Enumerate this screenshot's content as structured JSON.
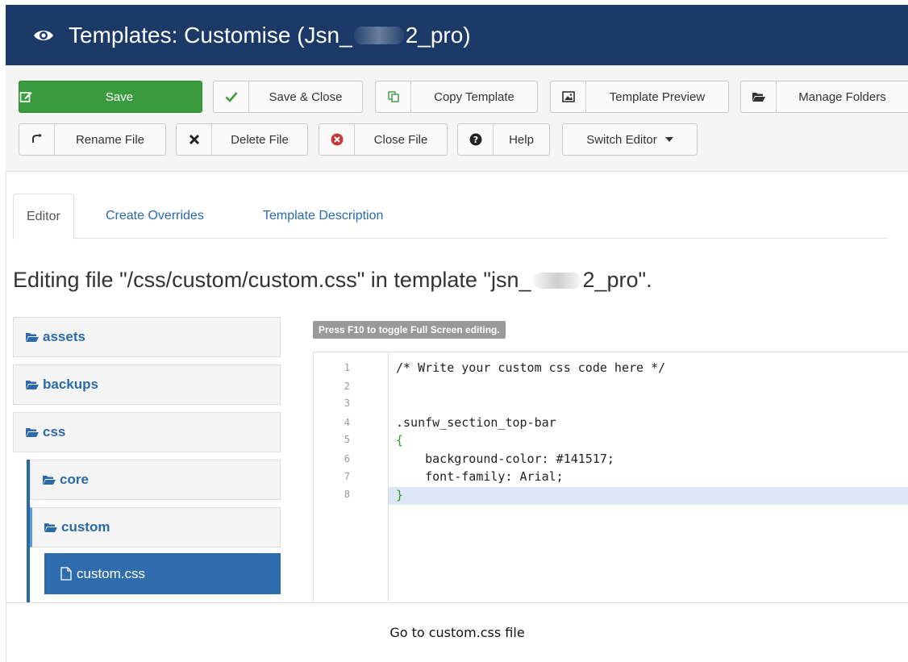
{
  "header": {
    "title_prefix": "Templates: Customise (Jsn_",
    "title_suffix": "2_pro)",
    "icon": "eye-icon",
    "bg_color": "#1b3a67"
  },
  "toolbar": {
    "save": "Save",
    "save_close": "Save & Close",
    "copy_template": "Copy Template",
    "template_preview": "Template Preview",
    "manage_folders": "Manage Folders",
    "rename_file": "Rename File",
    "delete_file": "Delete File",
    "close_file": "Close File",
    "help": "Help",
    "switch_editor": "Switch Editor",
    "save_color": "#3b9c3f"
  },
  "tabs": [
    {
      "label": "Editor",
      "active": true
    },
    {
      "label": "Create Overrides",
      "active": false
    },
    {
      "label": "Template Description",
      "active": false
    }
  ],
  "editing": {
    "prefix": "Editing file \"/css/custom/custom.css\" in template \"jsn_",
    "suffix": "2_pro\"."
  },
  "tree": {
    "items": [
      "assets",
      "backups",
      "css",
      "core",
      "custom"
    ],
    "active_file": "custom.css",
    "active_color": "#2f6cae"
  },
  "editor": {
    "f10_hint": "Press F10 to toggle Full Screen editing.",
    "line_numbers": [
      "1",
      "2",
      "3",
      "4",
      "5",
      "6",
      "7",
      "8"
    ],
    "lines": [
      "/* Write your custom css code here */",
      "",
      "",
      ".sunfw_section_top-bar",
      "{",
      "    background-color: #141517;",
      "    font-family: Arial;",
      "}"
    ],
    "highlighted_line": 8
  },
  "caption": "Go to custom.css file"
}
